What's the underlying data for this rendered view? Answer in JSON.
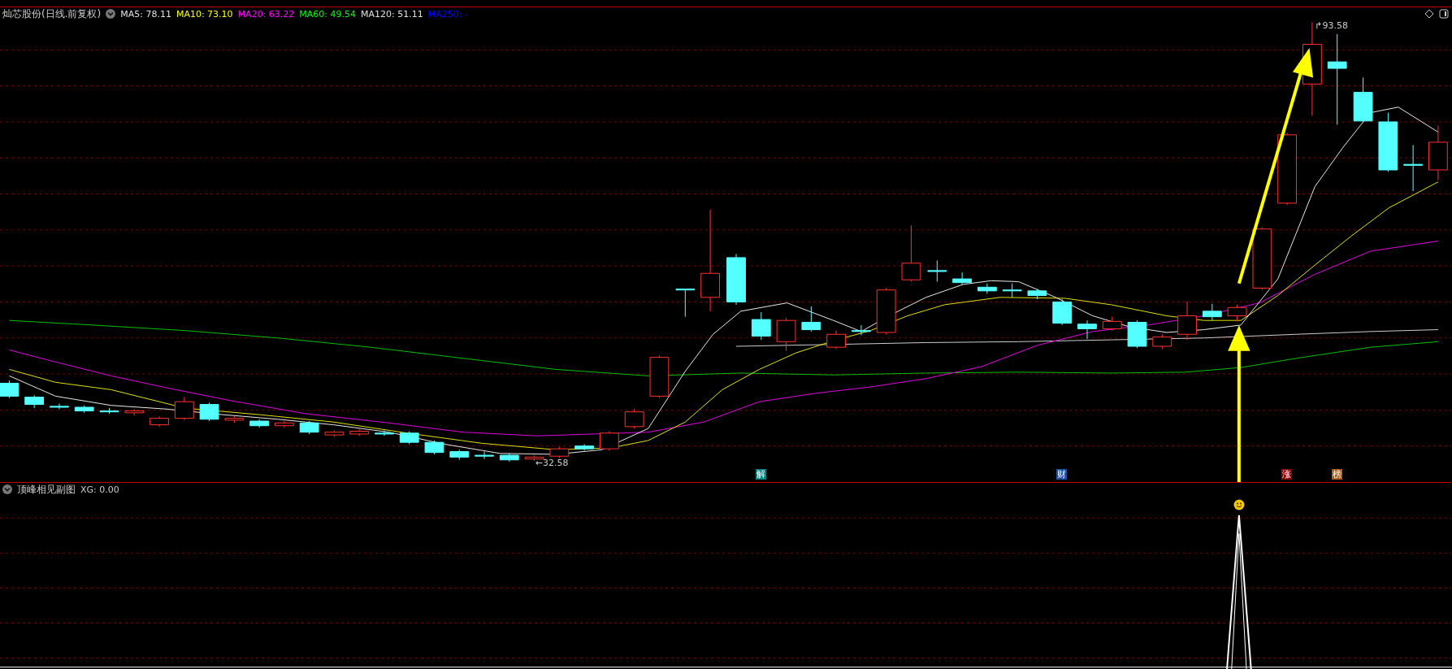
{
  "main_chart": {
    "title": "灿芯股份(日线.前复权)",
    "indicators": [
      {
        "label": "MA5: 78.11",
        "color": "#e0e0e0"
      },
      {
        "label": "MA10: 73.10",
        "color": "#ffff00"
      },
      {
        "label": "MA20: 63.22",
        "color": "#ff00ff"
      },
      {
        "label": "MA60: 49.54",
        "color": "#00ff00"
      },
      {
        "label": "MA120: 51.11",
        "color": "#e0e0e0"
      },
      {
        "label": "MA250: -",
        "color": "#0000ff"
      }
    ],
    "high_label": "↱93.58",
    "low_label": "←32.58",
    "event_markers": [
      {
        "label": "解",
        "color": "#008080"
      },
      {
        "label": "财",
        "color": "#1f4fa0"
      },
      {
        "label": "涨",
        "color": "#8b0000"
      },
      {
        "label": "榜",
        "color": "#b05a10"
      }
    ]
  },
  "sub_chart": {
    "title": "顶峰相见副图",
    "reading": "XG: 0.00"
  }
}
